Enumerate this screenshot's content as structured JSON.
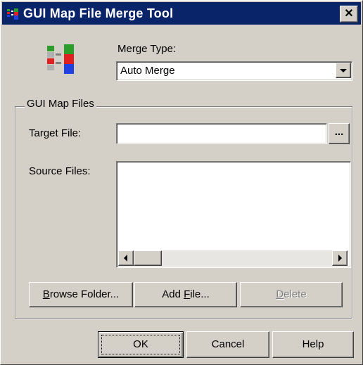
{
  "window": {
    "title": "GUI Map File Merge Tool",
    "close_glyph": "✕"
  },
  "merge_type": {
    "label": "Merge Type:",
    "selected": "Auto Merge"
  },
  "group": {
    "label": "GUI Map Files",
    "target_file_label": "Target File:",
    "target_file_value": "",
    "browse_small_label": "...",
    "source_files_label": "Source Files:",
    "browse_folder": {
      "pre": "",
      "key": "B",
      "post": "rowse Folder..."
    },
    "add_file": {
      "pre": "Add ",
      "key": "F",
      "post": "ile..."
    },
    "delete": {
      "pre": "",
      "key": "D",
      "post": "elete"
    }
  },
  "buttons": {
    "ok": "OK",
    "cancel": "Cancel",
    "help": "Help"
  },
  "icons": {
    "app": "merge-tool-icon",
    "merge_logo": "merge-tool-icon"
  }
}
